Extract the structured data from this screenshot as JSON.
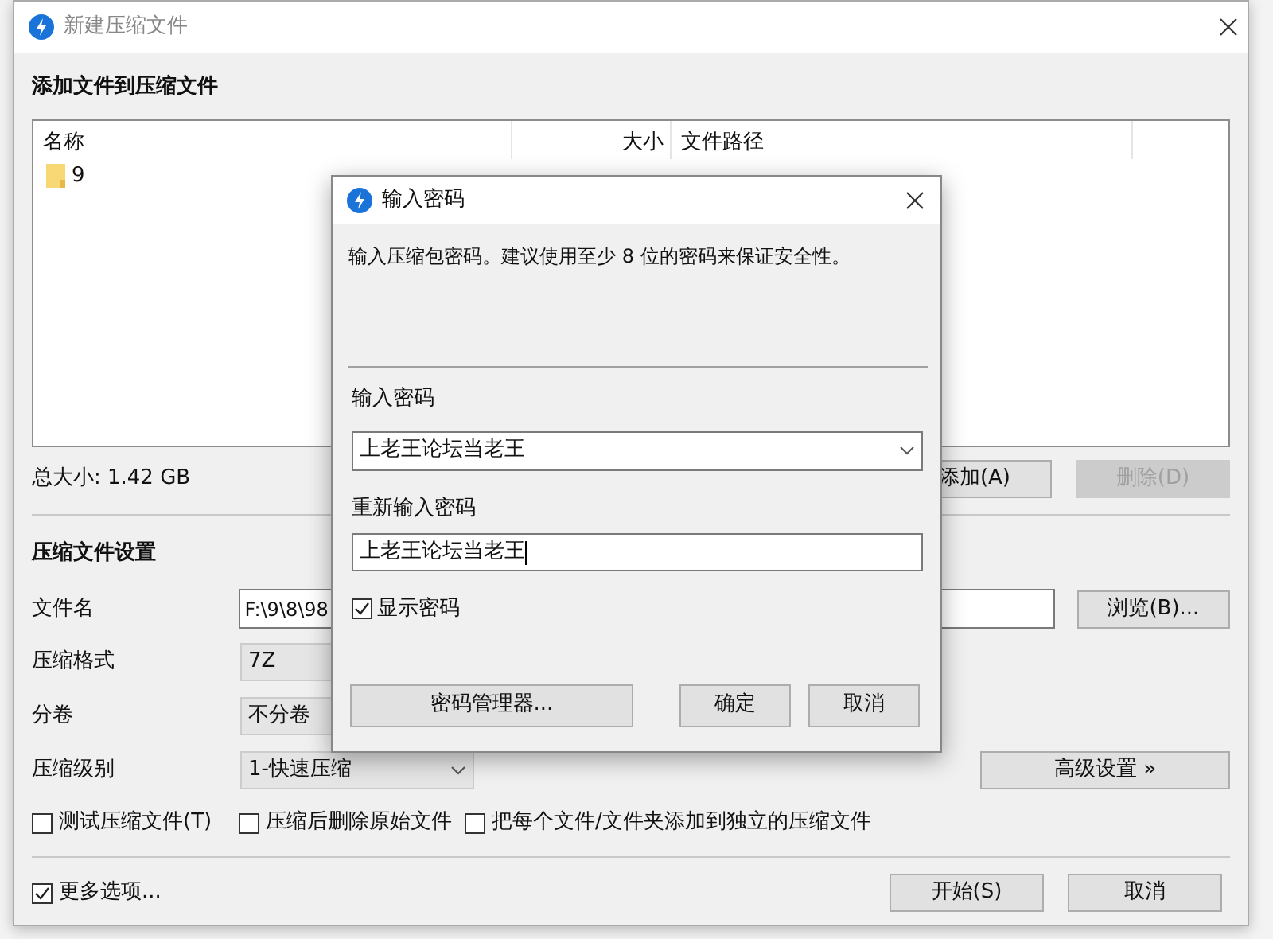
{
  "window": {
    "title": "新建压缩文件"
  },
  "files_section": {
    "heading": "添加文件到压缩文件",
    "columns": [
      "名称",
      "大小",
      "文件路径"
    ],
    "rows": [
      {
        "name": "9"
      }
    ],
    "total": "总大小: 1.42 GB",
    "buttons": [
      {
        "label": "添加(A)",
        "disabled": false
      },
      {
        "label": "删除(D)",
        "disabled": true
      }
    ]
  },
  "settings": {
    "heading": "压缩文件设置",
    "file_name": {
      "label": "文件名",
      "value": "F:\\9\\8\\98"
    },
    "browse_button": "浏览(B)...",
    "format": {
      "label": "压缩格式",
      "value": "7Z"
    },
    "split": {
      "label": "分卷",
      "value": "不分卷"
    },
    "level": {
      "label": "压缩级别",
      "value": "1-快速压缩"
    },
    "advanced_button": "高级设置 »",
    "options": [
      {
        "label": "测试压缩文件(T)",
        "checked": false
      },
      {
        "label": "压缩后删除原始文件",
        "checked": false
      },
      {
        "label": "把每个文件/文件夹添加到独立的压缩文件",
        "checked": false
      }
    ]
  },
  "more_options": {
    "label": "更多选项...",
    "checked": true
  },
  "footer_buttons": [
    "开始(S)",
    "取消"
  ],
  "password_dialog": {
    "title": "输入密码",
    "description": "输入压缩包密码。建议使用至少 8 位的密码来保证安全性。",
    "password_label": "输入密码",
    "password_value": "上老王论坛当老王",
    "confirm_label": "重新输入密码",
    "confirm_value": "上老王论坛当老王",
    "show_password": {
      "label": "显示密码",
      "checked": true
    },
    "manager_button": "密码管理器...",
    "buttons": [
      "确定",
      "取消"
    ]
  }
}
